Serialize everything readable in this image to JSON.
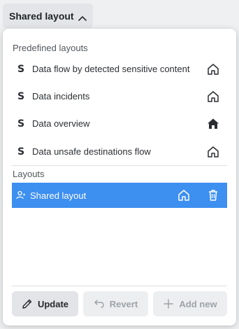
{
  "trigger": {
    "label": "Shared layout",
    "icon": "chevron-up-icon"
  },
  "predefined": {
    "title": "Predefined layouts",
    "items": [
      {
        "label": "Data flow by detected sensitive content",
        "icon": "s-logo-icon",
        "is_home": false
      },
      {
        "label": "Data incidents",
        "icon": "s-logo-icon",
        "is_home": false
      },
      {
        "label": "Data overview",
        "icon": "s-logo-icon",
        "is_home": true
      },
      {
        "label": "Data unsafe destinations flow",
        "icon": "s-logo-icon",
        "is_home": false
      }
    ]
  },
  "layouts": {
    "title": "Layouts",
    "items": [
      {
        "label": "Shared layout",
        "icon": "shared-user-icon",
        "selected": true
      }
    ]
  },
  "actions": {
    "update_label": "Update",
    "revert_label": "Revert",
    "add_label": "Add new"
  },
  "colors": {
    "selected_bg": "#3d8ff0",
    "home_filled": "#2a2d31"
  }
}
